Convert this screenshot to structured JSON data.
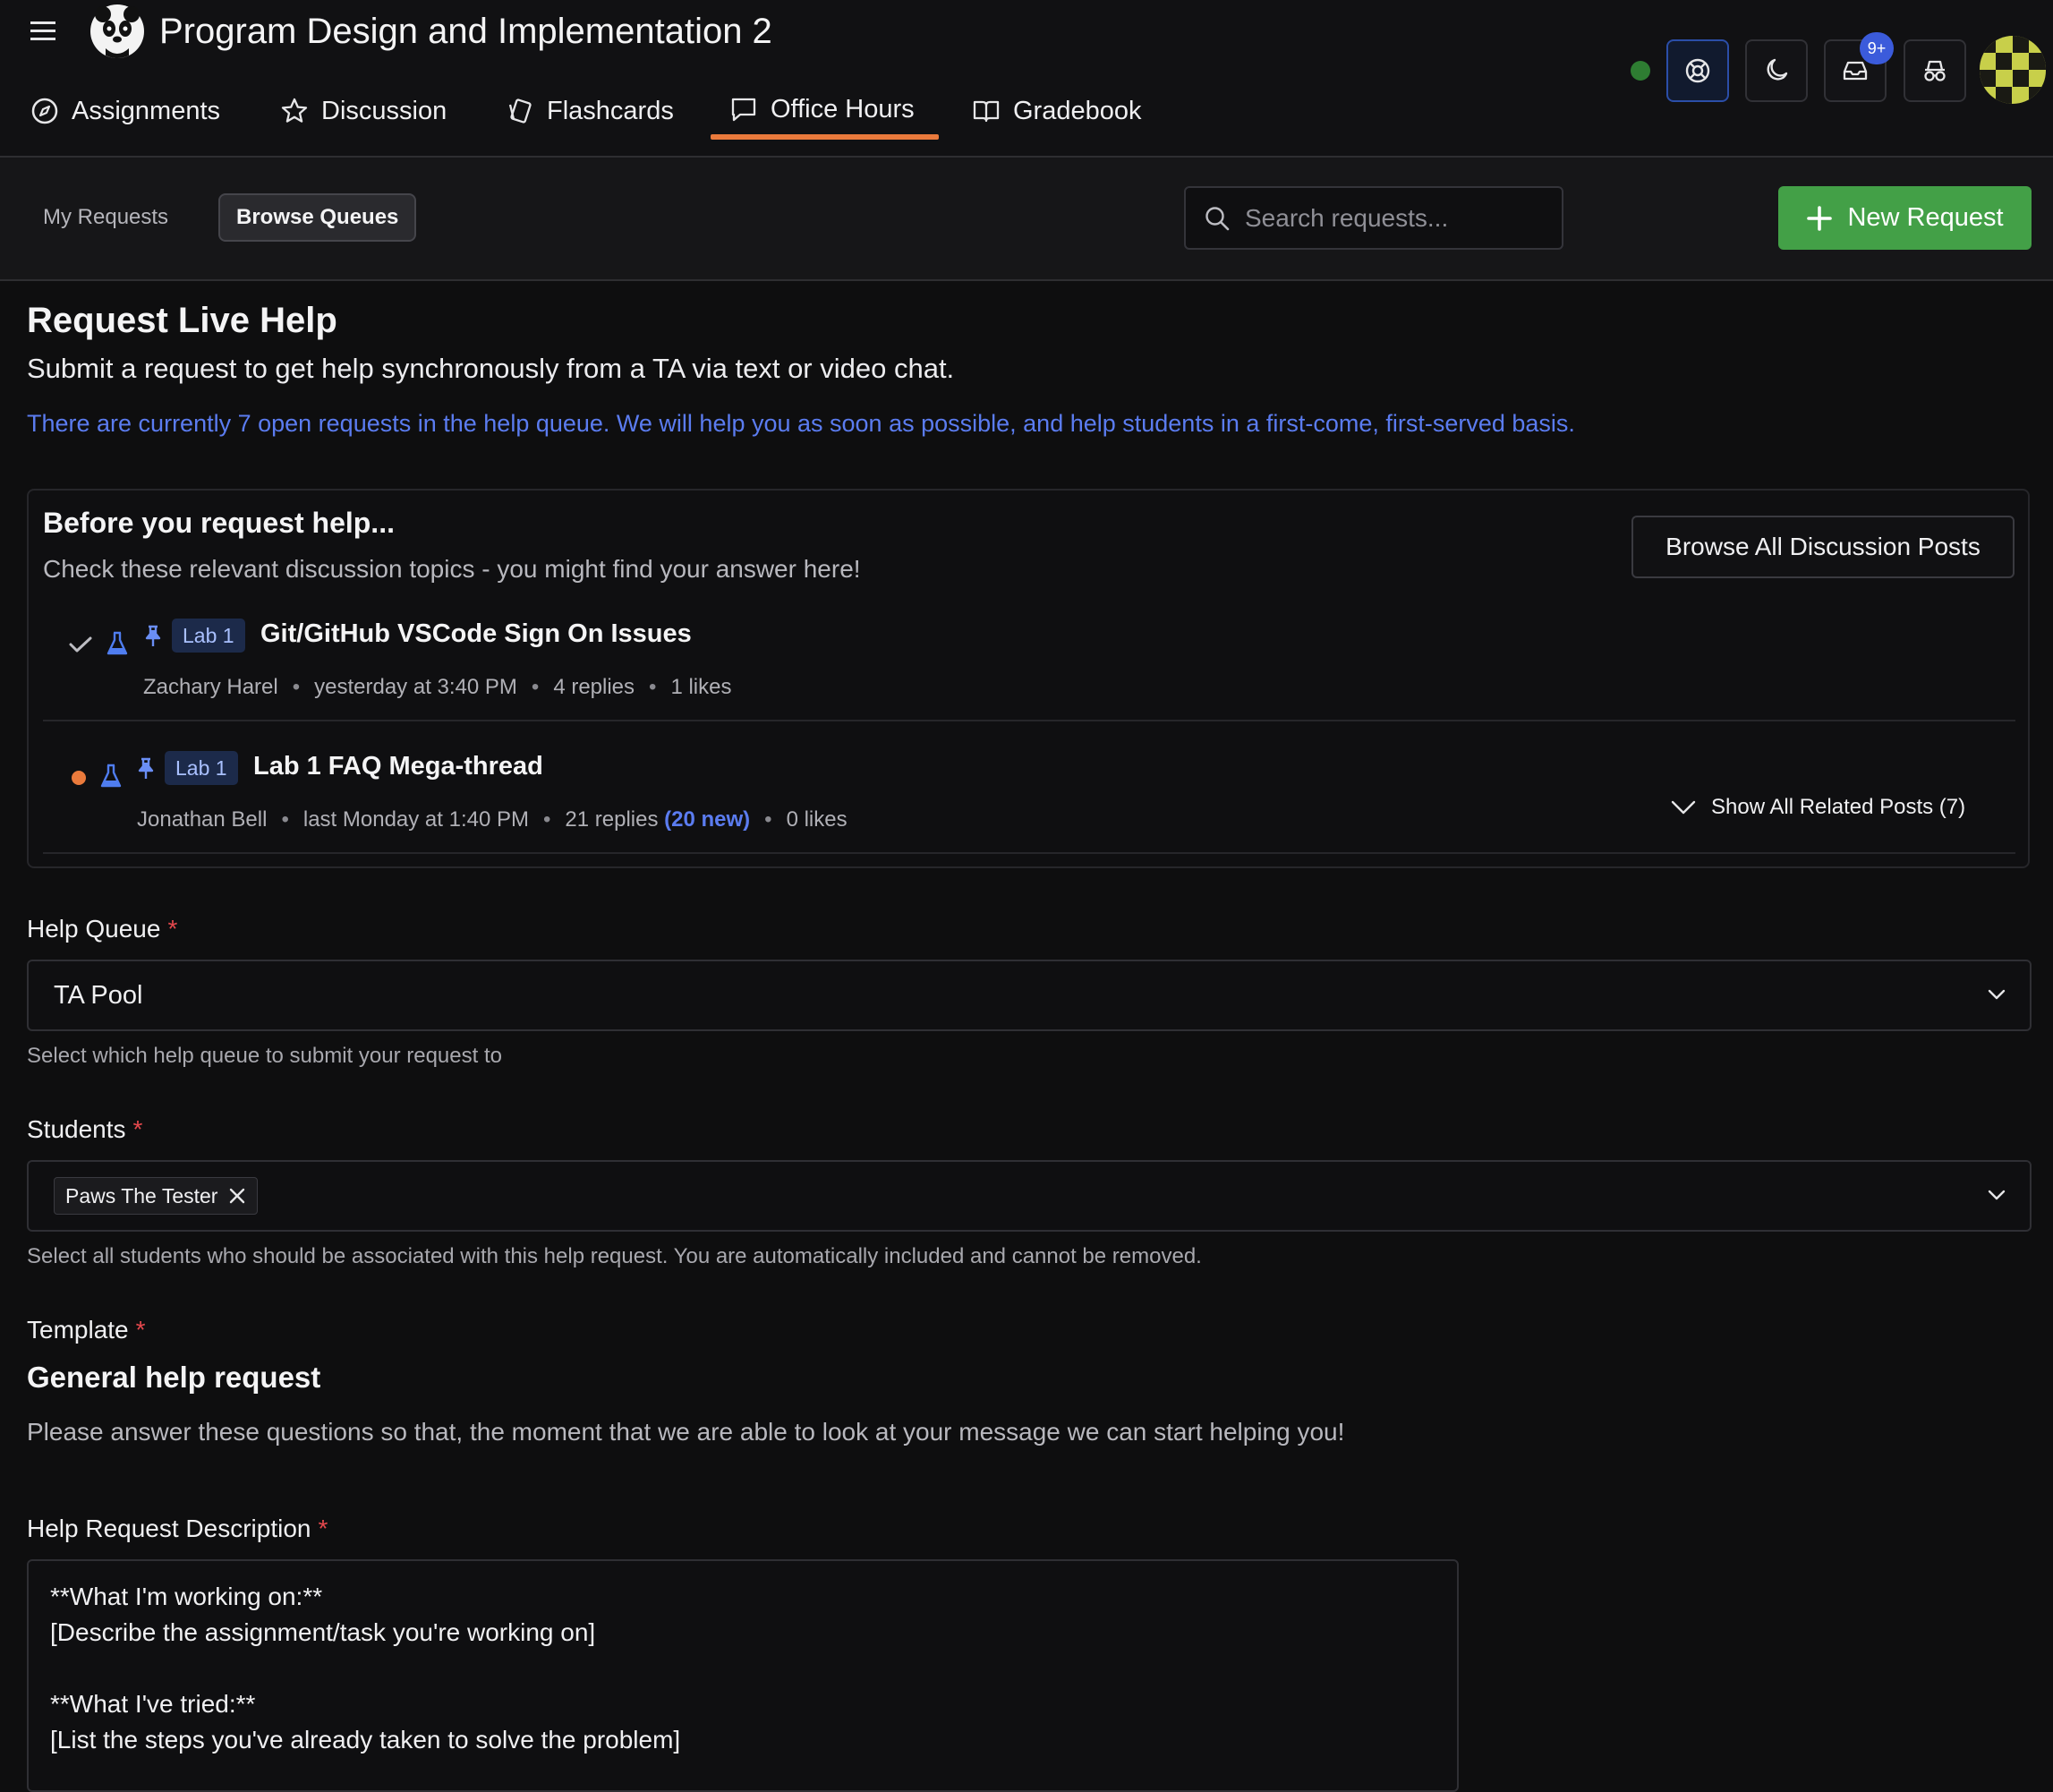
{
  "app": {
    "title": "Program Design and Implementation 2"
  },
  "nav": {
    "tabs": [
      {
        "label": "Assignments",
        "icon": "compass-icon"
      },
      {
        "label": "Discussion",
        "icon": "star-icon"
      },
      {
        "label": "Flashcards",
        "icon": "flashcards-icon"
      },
      {
        "label": "Office Hours",
        "icon": "chat-icon",
        "active": true
      },
      {
        "label": "Gradebook",
        "icon": "book-icon"
      }
    ]
  },
  "header": {
    "notification_badge": "9+",
    "status_color": "#2e7d32",
    "accent": "#ea7a3c"
  },
  "subnav": {
    "tabs": [
      {
        "label": "My Requests"
      },
      {
        "label": "Browse Queues",
        "active": true
      }
    ],
    "search_placeholder": "Search requests...",
    "new_request_label": "New Request"
  },
  "page": {
    "title": "Request Live Help",
    "subtitle": "Submit a request to get help synchronously from a TA via text or video chat.",
    "queue_note": "There are currently 7 open requests in the help queue. We will help you as soon as possible, and help students in a first-come, first-served basis."
  },
  "related": {
    "title": "Before you request help...",
    "subtitle": "Check these relevant discussion topics - you might find your answer here!",
    "browse_all_label": "Browse All Discussion Posts",
    "show_all_label": "Show All Related Posts (7)",
    "posts": [
      {
        "tag": "Lab 1",
        "title": "Git/GitHub VSCode Sign On Issues",
        "author": "Zachary Harel",
        "time": "yesterday at 3:40 PM",
        "replies": "4 replies",
        "new": "",
        "likes": "1 likes",
        "status": "read"
      },
      {
        "tag": "Lab 1",
        "title": "Lab 1 FAQ Mega-thread",
        "author": "Jonathan Bell",
        "time": "last Monday at 1:40 PM",
        "replies": "21 replies",
        "new": "(20 new)",
        "likes": "0 likes",
        "status": "unread"
      }
    ]
  },
  "form": {
    "queue": {
      "label": "Help Queue",
      "required": "*",
      "value": "TA Pool",
      "help": "Select which help queue to submit your request to"
    },
    "students": {
      "label": "Students",
      "required": "*",
      "chip": "Paws The Tester",
      "help": "Select all students who should be associated with this help request. You are automatically included and cannot be removed."
    },
    "template": {
      "label": "Template",
      "required": "*",
      "name": "General help request",
      "description": "Please answer these questions so that, the moment that we are able to look at your message we can start helping you!"
    },
    "description": {
      "label": "Help Request Description",
      "required": "*",
      "value": "**What I'm working on:**\n[Describe the assignment/task you're working on]\n\n**What I've tried:**\n[List the steps you've already taken to solve the problem]"
    }
  }
}
